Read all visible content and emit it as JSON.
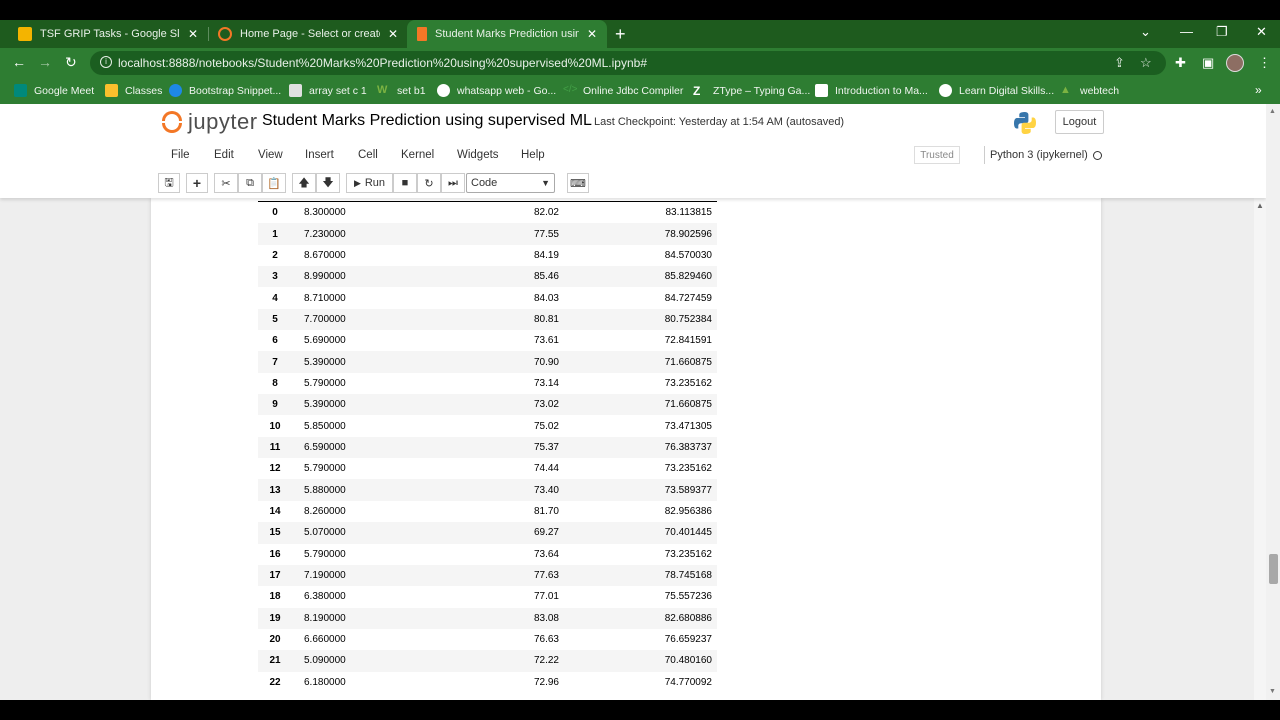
{
  "browser": {
    "tabs": [
      {
        "title": "TSF GRIP Tasks - Google Slides",
        "icon": "slides-icon",
        "color": "#f4b400"
      },
      {
        "title": "Home Page - Select or create a n",
        "icon": "jupyter-icon",
        "color": "#f37726"
      },
      {
        "title": "Student Marks Prediction using s",
        "icon": "notebook-icon",
        "color": "#f37726"
      }
    ],
    "url": "localhost:8888/notebooks/Student%20Marks%20Prediction%20using%20supervised%20ML.ipynb#",
    "bookmarks": [
      {
        "label": "Google Meet",
        "color": "#00897b"
      },
      {
        "label": "Classes",
        "color": "#fbc02d"
      },
      {
        "label": "Bootstrap Snippet...",
        "color": "#1e88e5"
      },
      {
        "label": "array set c 1",
        "color": "#e0e0e0"
      },
      {
        "label": "set b1",
        "color": "#7cb342"
      },
      {
        "label": "whatsapp web - Go...",
        "color": "#ffffff"
      },
      {
        "label": "Online Jdbc Compiler",
        "color": "#43a047"
      },
      {
        "label": "ZType – Typing Ga...",
        "color": "#ffffff"
      },
      {
        "label": "Introduction to Ma...",
        "color": "#ffffff"
      },
      {
        "label": "Learn Digital Skills...",
        "color": "#ffffff"
      },
      {
        "label": "webtech",
        "color": "#7cb342"
      }
    ]
  },
  "jupyter": {
    "logo_text": "jupyter",
    "notebook_title": "Student Marks Prediction using supervised ML",
    "checkpoint": "Last Checkpoint: Yesterday at 1:54 AM  (autosaved)",
    "logout_label": "Logout",
    "menus": [
      "File",
      "Edit",
      "View",
      "Insert",
      "Cell",
      "Kernel",
      "Widgets",
      "Help"
    ],
    "trusted_label": "Trusted",
    "kernel_label": "Python 3 (ipykernel)",
    "run_label": "Run",
    "cell_type": "Code"
  },
  "dataframe": {
    "rows": [
      [
        "0",
        "8.300000",
        "82.02",
        "83.113815"
      ],
      [
        "1",
        "7.230000",
        "77.55",
        "78.902596"
      ],
      [
        "2",
        "8.670000",
        "84.19",
        "84.570030"
      ],
      [
        "3",
        "8.990000",
        "85.46",
        "85.829460"
      ],
      [
        "4",
        "8.710000",
        "84.03",
        "84.727459"
      ],
      [
        "5",
        "7.700000",
        "80.81",
        "80.752384"
      ],
      [
        "6",
        "5.690000",
        "73.61",
        "72.841591"
      ],
      [
        "7",
        "5.390000",
        "70.90",
        "71.660875"
      ],
      [
        "8",
        "5.790000",
        "73.14",
        "73.235162"
      ],
      [
        "9",
        "5.390000",
        "73.02",
        "71.660875"
      ],
      [
        "10",
        "5.850000",
        "75.02",
        "73.471305"
      ],
      [
        "11",
        "6.590000",
        "75.37",
        "76.383737"
      ],
      [
        "12",
        "5.790000",
        "74.44",
        "73.235162"
      ],
      [
        "13",
        "5.880000",
        "73.40",
        "73.589377"
      ],
      [
        "14",
        "8.260000",
        "81.70",
        "82.956386"
      ],
      [
        "15",
        "5.070000",
        "69.27",
        "70.401445"
      ],
      [
        "16",
        "5.790000",
        "73.64",
        "73.235162"
      ],
      [
        "17",
        "7.190000",
        "77.63",
        "78.745168"
      ],
      [
        "18",
        "6.380000",
        "77.01",
        "75.557236"
      ],
      [
        "19",
        "8.190000",
        "83.08",
        "82.680886"
      ],
      [
        "20",
        "6.660000",
        "76.63",
        "76.659237"
      ],
      [
        "21",
        "5.090000",
        "72.22",
        "70.480160"
      ],
      [
        "22",
        "6.180000",
        "72.96",
        "74.770092"
      ]
    ]
  }
}
